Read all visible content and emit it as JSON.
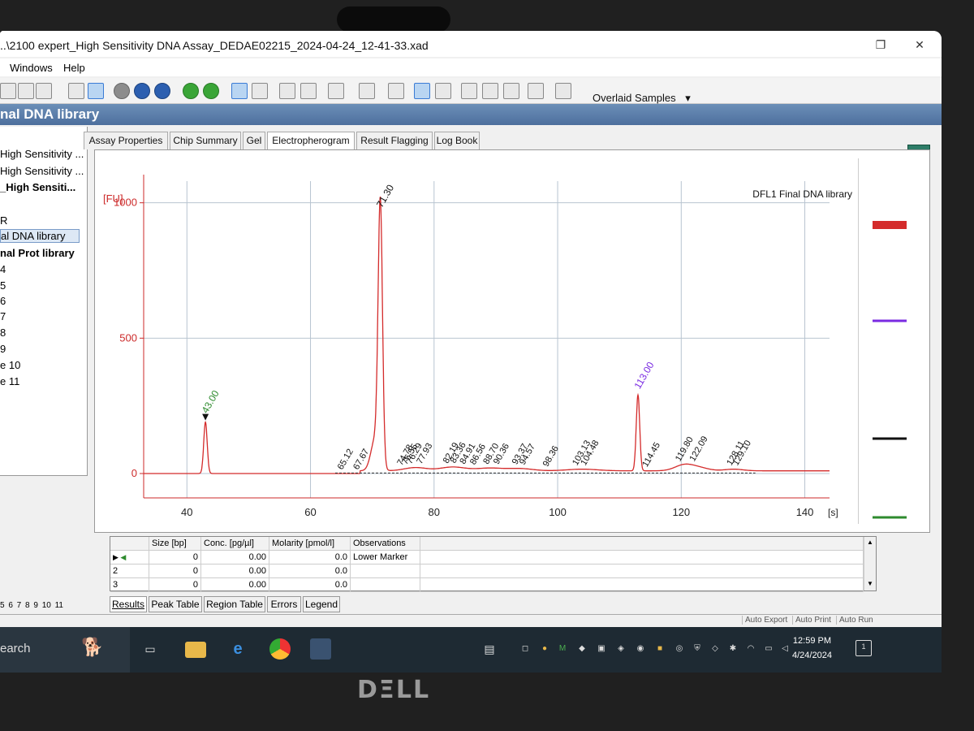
{
  "window": {
    "title": "..\\2100 expert_High Sensitivity DNA Assay_DEDAE02215_2024-04-24_12-41-33.xad",
    "restore_glyph": "❐",
    "close_glyph": "✕"
  },
  "menu": {
    "windows": "Windows",
    "help": "Help"
  },
  "toolbar": {
    "overlaid_label": "Overlaid Samples",
    "overlaid_arrow": "▾"
  },
  "header": {
    "sample_title": "nal DNA library"
  },
  "tree": {
    "items": [
      {
        "label": "High Sensitivity ..."
      },
      {
        "label": "High Sensitivity ..."
      },
      {
        "label": "_High Sensiti..."
      },
      {
        "label": "R"
      },
      {
        "label": "al DNA library"
      },
      {
        "label": "nal Prot library"
      },
      {
        "label": "4"
      },
      {
        "label": "5"
      },
      {
        "label": "6"
      },
      {
        "label": "7"
      },
      {
        "label": "8"
      },
      {
        "label": "9"
      },
      {
        "label": "e 10"
      },
      {
        "label": "e 11"
      }
    ],
    "lanes": "5 6 7 8 9 10 11"
  },
  "tabs": [
    {
      "label": "Assay Properties"
    },
    {
      "label": "Chip Summary"
    },
    {
      "label": "Gel"
    },
    {
      "label": "Electropherogram"
    },
    {
      "label": "Result Flagging"
    },
    {
      "label": "Log Book"
    }
  ],
  "chart_data": {
    "type": "line",
    "sample_label": "DFL1 Final DNA library",
    "ylabel": "[FU]",
    "xunit": "[s]",
    "xlim": [
      33,
      144
    ],
    "ylim": [
      -90,
      1080
    ],
    "x_ticks": [
      40,
      60,
      80,
      100,
      120,
      140
    ],
    "y_ticks": [
      0,
      500,
      1000
    ],
    "grid": true,
    "colors": {
      "trace": "#d42b2b",
      "lower_marker": "#2e8b2e",
      "upper_marker": "#7a2be2",
      "annotation": "#111111",
      "axis": "#cc2a2a"
    },
    "peaks": [
      {
        "x": 43.0,
        "height": 190,
        "label": "43.00",
        "kind": "lower_marker"
      },
      {
        "x": 71.3,
        "height": 950,
        "label": "71.30",
        "kind": "peak"
      },
      {
        "x": 113.0,
        "height": 280,
        "label": "113.00",
        "kind": "upper_marker"
      }
    ],
    "small_labels": [
      {
        "x": 65.12,
        "label": "65.12"
      },
      {
        "x": 67.67,
        "label": "67.67"
      },
      {
        "x": 74.78,
        "label": "74.78"
      },
      {
        "x": 75.55,
        "label": "75.55"
      },
      {
        "x": 76.29,
        "label": "76.29"
      },
      {
        "x": 77.93,
        "label": "77.93"
      },
      {
        "x": 82.19,
        "label": "82.19"
      },
      {
        "x": 83.36,
        "label": "83.36"
      },
      {
        "x": 84.91,
        "label": "84.91"
      },
      {
        "x": 86.56,
        "label": "86.56"
      },
      {
        "x": 88.7,
        "label": "88.70"
      },
      {
        "x": 90.36,
        "label": "90.36"
      },
      {
        "x": 93.37,
        "label": "93.37"
      },
      {
        "x": 94.57,
        "label": "94.57"
      },
      {
        "x": 98.36,
        "label": "98.36"
      },
      {
        "x": 103.13,
        "label": "103.13"
      },
      {
        "x": 104.48,
        "label": "104.48"
      },
      {
        "x": 114.45,
        "label": "114.45"
      },
      {
        "x": 119.8,
        "label": "119.80"
      },
      {
        "x": 122.09,
        "label": "122.09"
      },
      {
        "x": 128.11,
        "label": "128.11"
      },
      {
        "x": 129.1,
        "label": "129.10"
      }
    ],
    "right_legend_colors": [
      "#d42b2b",
      "#7a2be2",
      "#111111",
      "#2e8b2e"
    ],
    "right_legend_count": "2"
  },
  "peak_table": {
    "headers": [
      "Size [bp]",
      "Conc. [pg/µl]",
      "Molarity [pmol/l]",
      "Observations"
    ],
    "rows": [
      {
        "id": "",
        "size": "0",
        "conc": "0.00",
        "molarity": "0.0",
        "obs": "Lower Marker"
      },
      {
        "id": "2",
        "size": "0",
        "conc": "0.00",
        "molarity": "0.0",
        "obs": ""
      },
      {
        "id": "3",
        "size": "0",
        "conc": "0.00",
        "molarity": "0.0",
        "obs": ""
      }
    ]
  },
  "bottom_tabs": [
    {
      "label": "Results"
    },
    {
      "label": "Peak Table"
    },
    {
      "label": "Region Table"
    },
    {
      "label": "Errors"
    },
    {
      "label": "Legend"
    }
  ],
  "status": {
    "auto_export": "Auto Export",
    "auto_print": "Auto Print",
    "auto_run": "Auto Run"
  },
  "taskbar": {
    "search": "earch",
    "time": "12:59 PM",
    "date": "4/24/2024",
    "notification_count": "1"
  },
  "brand": "DΞLL"
}
